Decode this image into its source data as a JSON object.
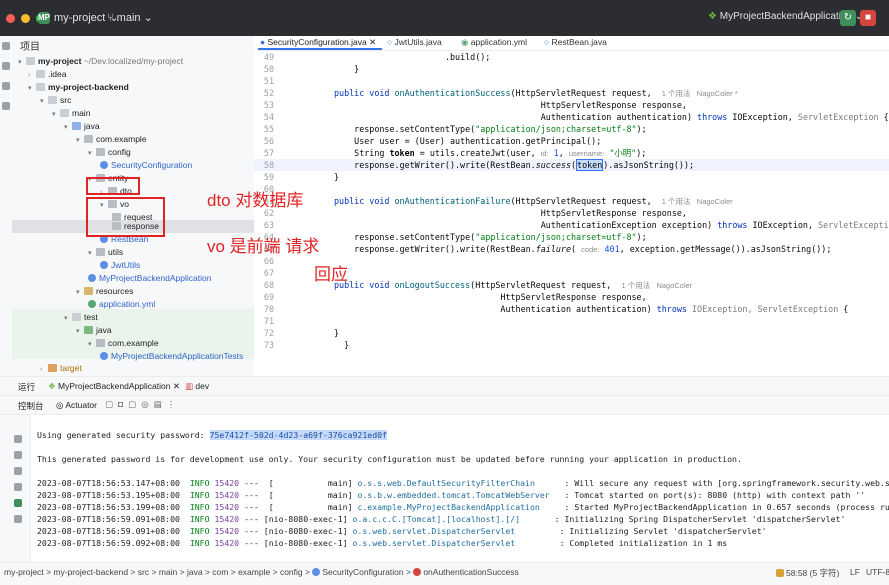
{
  "titlebar": {
    "project_badge": "MP",
    "project_name": "my-project",
    "branch": "main",
    "run_config": "MyProjectBackendApplication"
  },
  "project_panel": {
    "title": "项目",
    "tree": [
      {
        "label": "my-project",
        "suffix": "~/Dev.localized/my-project",
        "icon": "folder-icon"
      },
      {
        "label": ".idea",
        "icon": "folder-icon"
      },
      {
        "label": "my-project-backend",
        "icon": "folder-icon"
      },
      {
        "label": "src",
        "icon": "folder-icon"
      },
      {
        "label": "main",
        "icon": "folder-icon"
      },
      {
        "label": "java",
        "icon": "folder-icon"
      },
      {
        "label": "com.example",
        "icon": "package-icon"
      },
      {
        "label": "config",
        "icon": "package-icon"
      },
      {
        "label": "SecurityConfiguration",
        "icon": "class-icon"
      },
      {
        "label": "entity",
        "icon": "package-icon"
      },
      {
        "label": "dto",
        "icon": "package-icon"
      },
      {
        "label": "vo",
        "icon": "package-icon"
      },
      {
        "label": "request",
        "icon": "package-icon"
      },
      {
        "label": "response",
        "icon": "package-icon"
      },
      {
        "label": "RestBean",
        "icon": "class-icon"
      },
      {
        "label": "utils",
        "icon": "package-icon"
      },
      {
        "label": "JwtUtils",
        "icon": "class-icon"
      },
      {
        "label": "MyProjectBackendApplication",
        "icon": "class-icon"
      },
      {
        "label": "resources",
        "icon": "folder-icon"
      },
      {
        "label": "application.yml",
        "icon": "yaml-icon"
      },
      {
        "label": "test",
        "icon": "folder-icon"
      },
      {
        "label": "java",
        "icon": "folder-icon"
      },
      {
        "label": "com.example",
        "icon": "package-icon"
      },
      {
        "label": "MyProjectBackendApplicationTests",
        "icon": "class-icon"
      },
      {
        "label": "target",
        "icon": "folder-icon"
      }
    ]
  },
  "annotations": {
    "dto_note": "dto 对数据库",
    "vo_note": "vo 是前端 请求",
    "vo_note2": "回应"
  },
  "tabs": [
    {
      "label": "SecurityConfiguration.java",
      "active": true
    },
    {
      "label": "JwtUtils.java",
      "active": false
    },
    {
      "label": "application.yml",
      "active": false
    },
    {
      "label": "RestBean.java",
      "active": false
    }
  ],
  "code": {
    "l49_num": "49",
    "l49": ".build();",
    "l50_num": "50",
    "l50": "}",
    "l51_num": "51",
    "l52_num": "52",
    "l52_kw": "public void ",
    "l52_fn": "onAuthenticationSuccess",
    "l52_rest": "(HttpServletRequest request,",
    "l52_hint": "1 个用法   NagoColer *",
    "l53_num": "53",
    "l53": "HttpServletResponse response,",
    "l54_num": "54",
    "l54": "Authentication authentication) ",
    "l54_kw": "throws ",
    "l54_rest": "IOException, ",
    "l54_gray": "ServletException",
    "l54_end": " {",
    "l55_num": "55",
    "l55_a": "response.setContentType(",
    "l55_str": "\"application/json;charset=utf-8\"",
    "l55_b": ");",
    "l56_num": "56",
    "l56": "User user = (User) authentication.getPrincipal();",
    "l57_num": "57",
    "l57_a": "String ",
    "l57_b": "token",
    "l57_c": " = utils.createJwt(user, ",
    "l57_h1": "id:",
    "l57_n1": " 1",
    "l57_d": ", ",
    "l57_h2": "username:",
    "l57_s": " \"小明\"",
    "l57_e": ");",
    "l58_num": "58",
    "l58_a": "response.getWriter().write(RestBean.",
    "l58_fn": "success",
    "l58_b": "(",
    "l58_tok": "token",
    "l58_c": ").asJsonString());",
    "l59_num": "59",
    "l59": "}",
    "l60_num": "60",
    "l61_num": "61",
    "l61_kw": "public void ",
    "l61_fn": "onAuthenticationFailure",
    "l61_rest": "(HttpServletRequest request,",
    "l61_hint": "1 个用法   NagoColer",
    "l62_num": "62",
    "l62": "HttpServletResponse response,",
    "l63_num": "63",
    "l63": "AuthenticationException exception) ",
    "l63_kw": "throws ",
    "l63_rest": "IOException, ",
    "l63_gray": "ServletException",
    "l63_end": " {",
    "l64_num": "64",
    "l64_a": "response.setContentType(",
    "l64_str": "\"application/json;charset=utf-8\"",
    "l64_b": ");",
    "l65_num": "65",
    "l65_a": "response.getWriter().write(RestBean.",
    "l65_fn": "failure",
    "l65_b": "( ",
    "l65_h": "code:",
    "l65_n": " 401",
    "l65_c": ", exception.getMessage()).asJsonString());",
    "l66_num": "66",
    "l67_num": "67",
    "l68_num": "68",
    "l68_kw": "public void ",
    "l68_fn": "onLogoutSuccess",
    "l68_rest": "(HttpServletRequest request,",
    "l68_hint": "1 个用法   NagoColer",
    "l69_num": "69",
    "l69": "HttpServletResponse response,",
    "l70_num": "70",
    "l70": "Authentication authentication) ",
    "l70_kw": "throws ",
    "l70_gray": "IOException, ServletException",
    "l70_end": " {",
    "l71_num": "71",
    "l72_num": "72",
    "l72": "}",
    "l73_num": "73",
    "l73": "}"
  },
  "run_panel": {
    "header_label": "运行",
    "run_tab": "MyProjectBackendApplication",
    "dev_tab": "dev",
    "console_label": "控制台",
    "actuator_label": "Actuator"
  },
  "console": {
    "pw_prefix": "Using generated security password: ",
    "pw_value": "75e7412f-502d-4d23-a69f-376ca921ed0f",
    "warning": "This generated password is for development use only. Your security configuration must be updated before running your application in production.",
    "logs": [
      {
        "time": "2023-08-07T18:56:53.147+08:00",
        "level": "INFO",
        "pid": "15420",
        "thread": "---  [           main]",
        "logger": "o.s.s.web.DefaultSecurityFilterChain     ",
        "msg": ": Will secure any request with [org.springframework.security.web.sessi"
      },
      {
        "time": "2023-08-07T18:56:53.195+08:00",
        "level": "INFO",
        "pid": "15420",
        "thread": "---  [           main]",
        "logger": "o.s.b.w.embedded.tomcat.TomcatWebServer  ",
        "msg": ": Tomcat started on port(s): 8080 (http) with context path ''"
      },
      {
        "time": "2023-08-07T18:56:53.199+08:00",
        "level": "INFO",
        "pid": "15420",
        "thread": "---  [           main]",
        "logger": "c.example.MyProjectBackendApplication    ",
        "msg": ": Started MyProjectBackendApplication in 0.657 seconds (process running"
      },
      {
        "time": "2023-08-07T18:56:59.091+08:00",
        "level": "INFO",
        "pid": "15420",
        "thread": "--- [nio-8080-exec-1]",
        "logger": "o.a.c.c.C.[Tomcat].[localhost].[/]      ",
        "msg": ": Initializing Spring DispatcherServlet 'dispatcherServlet'"
      },
      {
        "time": "2023-08-07T18:56:59.091+08:00",
        "level": "INFO",
        "pid": "15420",
        "thread": "--- [nio-8080-exec-1]",
        "logger": "o.s.web.servlet.DispatcherServlet        ",
        "msg": ": Initializing Servlet 'dispatcherServlet'"
      },
      {
        "time": "2023-08-07T18:56:59.092+08:00",
        "level": "INFO",
        "pid": "15420",
        "thread": "--- [nio-8080-exec-1]",
        "logger": "o.s.web.servlet.DispatcherServlet        ",
        "msg": ": Completed initialization in 1 ms"
      }
    ]
  },
  "statusbar": {
    "crumbs": [
      "my-project",
      "my-project-backend",
      "src",
      "main",
      "java",
      "com",
      "example",
      "config",
      "SecurityConfiguration",
      "onAuthenticationSuccess"
    ],
    "sep": ">",
    "position": "58:58 (5 字符)",
    "line_sep": "LF",
    "encoding": "UTF-8"
  }
}
